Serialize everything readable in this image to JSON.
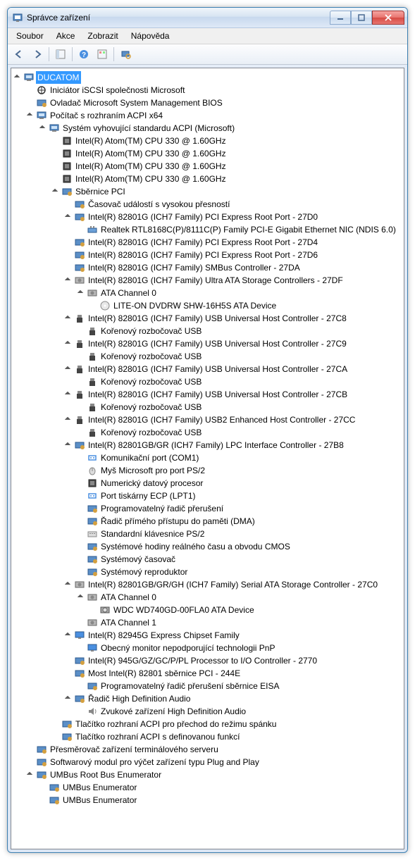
{
  "window": {
    "title": "Správce zařízení"
  },
  "menu": {
    "file": "Soubor",
    "action": "Akce",
    "view": "Zobrazit",
    "help": "Nápověda"
  },
  "tree": {
    "root": "DUCATOM",
    "n1": "Iniciátor iSCSI společnosti Microsoft",
    "n2": "Ovladač Microsoft System Management BIOS",
    "n3": "Počítač s rozhraním ACPI x64",
    "n3_1": "Systém vyhovující standardu ACPI (Microsoft)",
    "cpu1": "Intel(R) Atom(TM) CPU  330   @ 1.60GHz",
    "cpu2": "Intel(R) Atom(TM) CPU  330   @ 1.60GHz",
    "cpu3": "Intel(R) Atom(TM) CPU  330   @ 1.60GHz",
    "cpu4": "Intel(R) Atom(TM) CPU  330   @ 1.60GHz",
    "pci": "Sběrnice PCI",
    "timer": "Časovač událostí s vysokou přesností",
    "port27d0": "Intel(R) 82801G (ICH7 Family) PCI Express Root Port - 27D0",
    "realtek": "Realtek RTL8168C(P)/8111C(P) Family PCI-E Gigabit Ethernet NIC (NDIS 6.0)",
    "port27d4": "Intel(R) 82801G (ICH7 Family) PCI Express Root Port - 27D4",
    "port27d6": "Intel(R) 82801G (ICH7 Family) PCI Express Root Port - 27D6",
    "smbus": "Intel(R) 82801G (ICH7 Family) SMBus Controller - 27DA",
    "ata27df": "Intel(R) 82801G (ICH7 Family) Ultra ATA Storage Controllers - 27DF",
    "atach0a": "ATA Channel 0",
    "liteon": "LITE-ON DVDRW SHW-16H5S ATA Device",
    "usb27c8": "Intel(R) 82801G (ICH7 Family) USB Universal Host Controller - 27C8",
    "roothub": "Kořenový rozbočovač USB",
    "usb27c9": "Intel(R) 82801G (ICH7 Family) USB Universal Host Controller - 27C9",
    "usb27ca": "Intel(R) 82801G (ICH7 Family) USB Universal Host Controller - 27CA",
    "usb27cb": "Intel(R) 82801G (ICH7 Family) USB Universal Host Controller - 27CB",
    "usb27cc": "Intel(R) 82801G (ICH7 Family) USB2 Enhanced Host Controller - 27CC",
    "lpc": "Intel(R) 82801GB/GR (ICH7 Family) LPC Interface Controller - 27B8",
    "com1": "Komunikační port (COM1)",
    "mouse": "Myš Microsoft pro port PS/2",
    "numeric": "Numerický datový procesor",
    "lpt1": "Port tiskárny ECP (LPT1)",
    "progint": "Programovatelný řadič přerušení",
    "dma": "Řadič přímého přístupu do paměti (DMA)",
    "keyboard": "Standardní klávesnice PS/2",
    "cmos": "Systémové hodiny reálného času a obvodu CMOS",
    "systimer": "Systémový časovač",
    "speaker": "Systémový reproduktor",
    "sata": "Intel(R) 82801GB/GR/GH (ICH7 Family) Serial ATA Storage Controller - 27C0",
    "atach0b": "ATA Channel 0",
    "wdc": "WDC WD740GD-00FLA0 ATA Device",
    "atach1": "ATA Channel 1",
    "chipset": "Intel(R) 82945G Express Chipset Family",
    "monitor": "Obecný monitor nepodporující technologii PnP",
    "io2770": "Intel(R) 945G/GZ/GC/P/PL Processor to I/O Controller - 2770",
    "pci244e": "Most Intel(R) 82801 sběrnice PCI - 244E",
    "eisa": "Programovatelný řadič přerušení sběrnice EISA",
    "hdaudio": "Řadič High Definition Audio",
    "audiodev": "Zvukové zařízení High Definition Audio",
    "acpisleep": "Tlačítko rozhraní ACPI pro přechod do režimu spánku",
    "acpifunc": "Tlačítko rozhraní ACPI s definovanou funkcí",
    "terminal": "Přesměrovač zařízení terminálového serveru",
    "pnp": "Softwarový modul pro výčet zařízení typu Plug and Play",
    "umbus": "UMBus Root Bus Enumerator",
    "umbus1": "UMBus Enumerator",
    "umbus2": "UMBus Enumerator"
  }
}
